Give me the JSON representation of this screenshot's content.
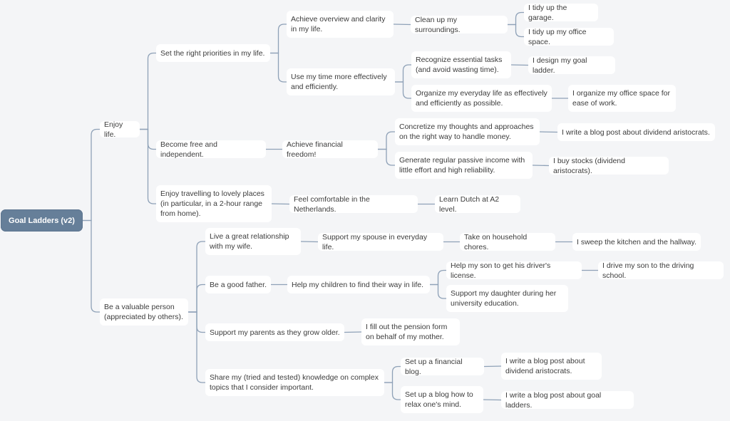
{
  "title": "Goal Ladders (v2)",
  "colors": {
    "background": "#f4f5f7",
    "root": "#667f99",
    "node": "#ffffff",
    "link": "#8ea1b7",
    "text": "#3c3c3c"
  },
  "nodes": {
    "root": "Goal Ladders (v2)",
    "enjoy": "Enjoy life.",
    "priorities": "Set the right priorities in my life.",
    "overview": "Achieve overview and clarity\nin my life.",
    "cleanup": "Clean up my surroundings.",
    "garage": "I tidy up the garage.",
    "office": "I tidy up my office space.",
    "time": "Use my time more effectively\nand efficiently.",
    "recognize": "Recognize essential tasks\n(and avoid wasting time).",
    "ladder": "I design my goal ladder.",
    "organize": "Organize my everyday life as effectively\nand efficiently as possible.",
    "officeorg": "I organize my office space for\nease of work.",
    "free": "Become free and independent.",
    "financial": "Achieve financial freedom!",
    "concretize": "Concretize my thoughts and approaches\non the right way to handle money.",
    "blogdiv1": "I write a blog post about dividend aristocrats.",
    "passive": "Generate regular passive income with\nlittle effort and high reliability.",
    "stocks": "I buy stocks (dividend aristocrats).",
    "travel": "Enjoy travelling to lovely places\n(in particular, in a 2-hour range\nfrom home).",
    "netherlands": "Feel comfortable in the Netherlands.",
    "dutch": "Learn Dutch at A2 level.",
    "valuable": "Be a valuable person\n(appreciated by others).",
    "relationship": "Live a great relationship\nwith my wife.",
    "spouse": "Support my spouse in everyday life.",
    "chores": "Take on household chores.",
    "sweep": "I sweep the kitchen and the hallway.",
    "father": "Be a good father.",
    "children": "Help my children to find their way in life.",
    "son": "Help my son to get his driver's license.",
    "drive": "I drive my son to the driving school.",
    "daughter": "Support my daughter during her\nuniversity education.",
    "parents": "Support my parents as they grow older.",
    "pension": "I fill out the pension form\non behalf of my mother.",
    "share": "Share my (tried and tested) knowledge on complex\ntopics that I consider important.",
    "finblog": "Set up a financial blog.",
    "blogdiv2": "I write a blog post about\ndividend aristocrats.",
    "relaxblog": "Set up a blog how to\nrelax one's mind.",
    "goalblog": "I write a blog post about goal ladders."
  },
  "edges": [
    [
      "root",
      "enjoy"
    ],
    [
      "root",
      "valuable"
    ],
    [
      "enjoy",
      "priorities"
    ],
    [
      "enjoy",
      "free"
    ],
    [
      "enjoy",
      "travel"
    ],
    [
      "priorities",
      "overview"
    ],
    [
      "priorities",
      "time"
    ],
    [
      "overview",
      "cleanup"
    ],
    [
      "cleanup",
      "garage"
    ],
    [
      "cleanup",
      "office"
    ],
    [
      "time",
      "recognize"
    ],
    [
      "time",
      "organize"
    ],
    [
      "recognize",
      "ladder"
    ],
    [
      "organize",
      "officeorg"
    ],
    [
      "free",
      "financial"
    ],
    [
      "financial",
      "concretize"
    ],
    [
      "financial",
      "passive"
    ],
    [
      "concretize",
      "blogdiv1"
    ],
    [
      "passive",
      "stocks"
    ],
    [
      "travel",
      "netherlands"
    ],
    [
      "netherlands",
      "dutch"
    ],
    [
      "valuable",
      "relationship"
    ],
    [
      "valuable",
      "father"
    ],
    [
      "valuable",
      "parents"
    ],
    [
      "valuable",
      "share"
    ],
    [
      "relationship",
      "spouse"
    ],
    [
      "spouse",
      "chores"
    ],
    [
      "chores",
      "sweep"
    ],
    [
      "father",
      "children"
    ],
    [
      "children",
      "son"
    ],
    [
      "children",
      "daughter"
    ],
    [
      "son",
      "drive"
    ],
    [
      "parents",
      "pension"
    ],
    [
      "share",
      "finblog"
    ],
    [
      "share",
      "relaxblog"
    ],
    [
      "finblog",
      "blogdiv2"
    ],
    [
      "relaxblog",
      "goalblog"
    ]
  ]
}
